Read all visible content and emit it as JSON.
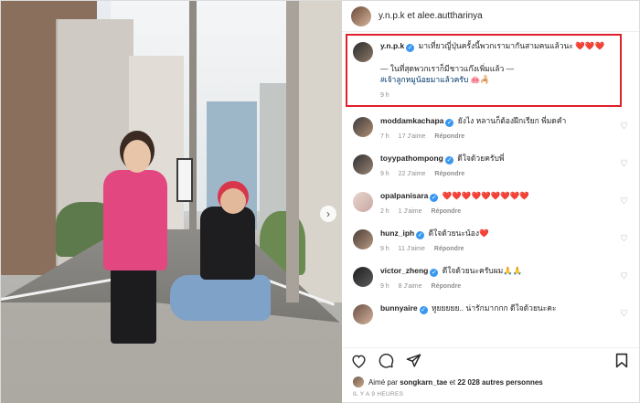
{
  "header": {
    "names": "y.n.p.k et alee.auttharinya"
  },
  "caption": {
    "username": "y.n.p.k",
    "line1": "มาเที่ยวญี่ปุ่นครั้งนี้พวกเรามากันสามคนแล้วนะ",
    "hearts": "❤️❤️❤️",
    "line2": "— ในที่สุดพวกเราก็มีชาวแก๊งเพิ่มแล้ว —",
    "hashtag": "#เจ้าลูกหมูน้อยมาแล้วครับ",
    "emoji": "🐽🦂",
    "time": "9 h"
  },
  "comments": [
    {
      "username": "moddamkachapa",
      "text": "ยังไง หลานก็ต้องฝึกเรียก พี่มดคำ",
      "time": "7 h",
      "likes": "17 J'aime",
      "reply": "Répondre",
      "verified": true
    },
    {
      "username": "toyypathompong",
      "text": "ดีใจด้วยครับพี่",
      "time": "9 h",
      "likes": "22 J'aime",
      "reply": "Répondre",
      "verified": true
    },
    {
      "username": "opalpanisara",
      "text": "❤️❤️❤️❤️❤️❤️❤️❤️❤️",
      "time": "2 h",
      "likes": "1 J'aime",
      "reply": "Répondre",
      "verified": true
    },
    {
      "username": "hunz_iph",
      "text": "ดีใจด้วยนะน้อง❤️",
      "time": "9 h",
      "likes": "11 J'aime",
      "reply": "Répondre",
      "verified": true
    },
    {
      "username": "victor_zheng",
      "text": "ดีใจด้วยนะครับผม🙏🙏",
      "time": "9 h",
      "likes": "8 J'aime",
      "reply": "Répondre",
      "verified": true
    },
    {
      "username": "bunnyaire",
      "text": "หูยยยยย.. น่ารักมากกก ดีใจด้วยนะคะ",
      "time": "",
      "likes": "",
      "reply": "",
      "verified": true
    }
  ],
  "likes": {
    "prefix": "Aimé par",
    "user": "songkarn_tae",
    "connector": "et",
    "others": "22 028 autres personnes"
  },
  "post_time": "IL Y A 9 HEURES",
  "icons": [
    "heart-icon",
    "comment-icon",
    "share-icon",
    "bookmark-icon",
    "chevron-right-icon"
  ],
  "colors": {
    "highlight_border": "#e0202a",
    "verified": "#3897f0",
    "hashtag": "#00376b"
  }
}
